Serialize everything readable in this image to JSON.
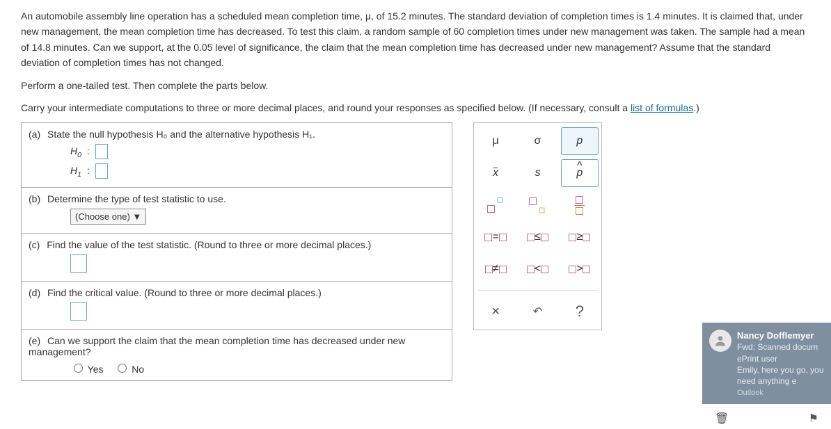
{
  "problem": {
    "p1": "An automobile assembly line operation has a scheduled mean completion time, μ, of 15.2 minutes. The standard deviation of completion times is 1.4 minutes. It is claimed that, under new management, the mean completion time has decreased. To test this claim, a random sample of 60 completion times under new management was taken. The sample had a mean of 14.8 minutes. Can we support, at the 0.05 level of significance, the claim that the mean completion time has decreased under new management? Assume that the standard deviation of completion times has not changed.",
    "p2": "Perform a one-tailed test. Then complete the parts below.",
    "p3_pre": "Carry your intermediate computations to three or more decimal places, and round your responses as specified below. (If necessary, consult a ",
    "p3_link": "list of formulas",
    "p3_post": ".)"
  },
  "parts": {
    "a": {
      "label": "(a)",
      "text": "State the null hypothesis H₀ and the alternative hypothesis H₁.",
      "h0": "H",
      "h0sub": "0",
      "h1": "H",
      "h1sub": "1",
      "colon": ":"
    },
    "b": {
      "label": "(b)",
      "text": "Determine the type of test statistic to use.",
      "choose": "(Choose one) ▼"
    },
    "c": {
      "label": "(c)",
      "text": "Find the value of the test statistic. (Round to three or more decimal places.)"
    },
    "d": {
      "label": "(d)",
      "text": "Find the critical value. (Round to three or more decimal places.)"
    },
    "e": {
      "label": "(e)",
      "text": "Can we support the claim that the mean completion time has decreased under new management?",
      "yes": "Yes",
      "no": "No"
    }
  },
  "palette": {
    "mu": "μ",
    "sigma": "σ",
    "p": "p",
    "xbar": "x",
    "s": "s",
    "phat": "p",
    "eq": "=",
    "le": "≤",
    "ge": "≥",
    "ne": "≠",
    "lt": "<",
    "gt": ">",
    "close": "✕",
    "undo": "↶",
    "help": "?"
  },
  "notification": {
    "sender": "Nancy Dofflemyer",
    "subject": "Fwd: Scanned docum",
    "sub2": "ePrint user",
    "preview": "Emily,  here you go, you need anything e",
    "app": "Outlook",
    "trash": "🗑",
    "flag": "⚑"
  }
}
